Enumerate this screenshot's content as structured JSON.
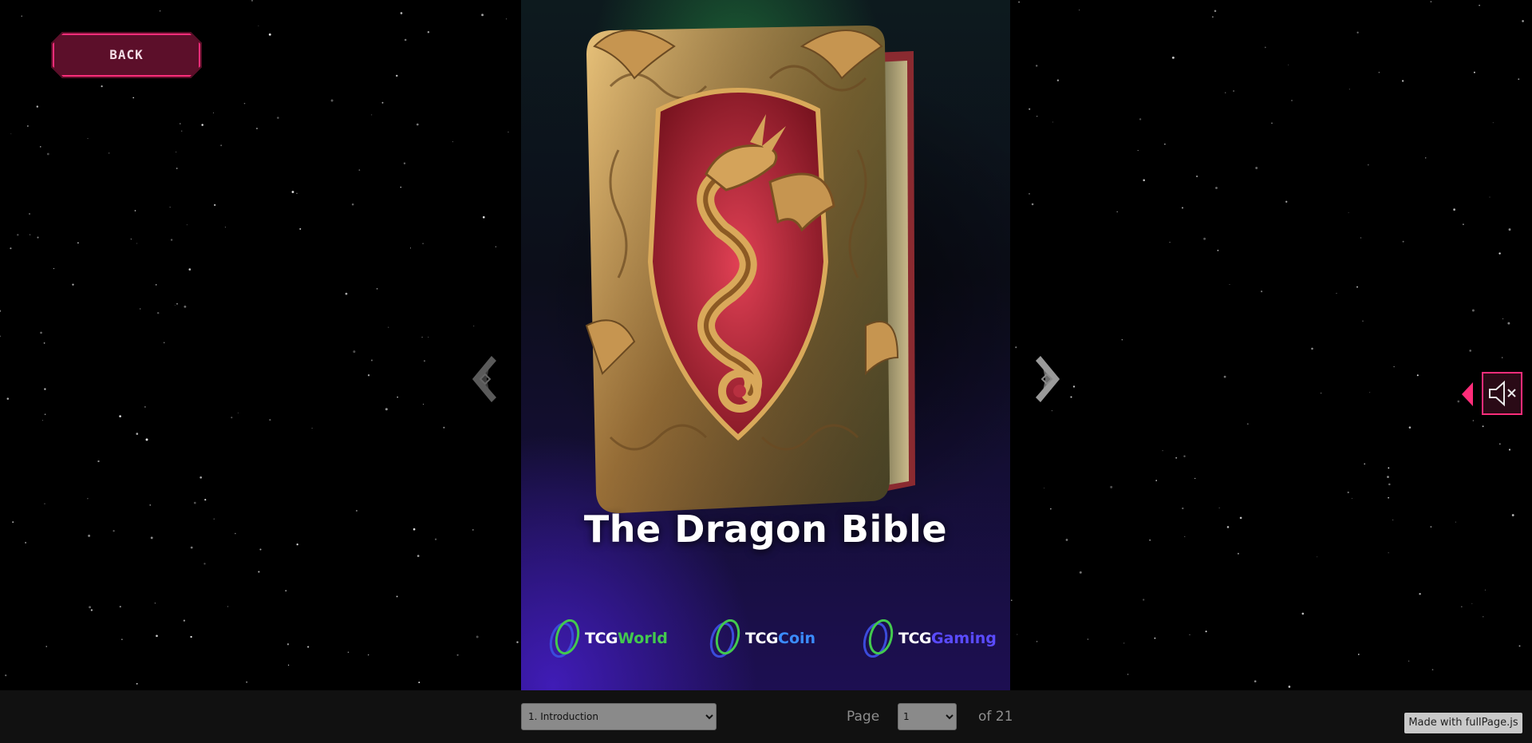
{
  "back_button": {
    "label": "BACK"
  },
  "book": {
    "title": "The Dragon Bible",
    "logos": [
      {
        "prefix": "TCG",
        "suffix": "World",
        "suffix_color": "#43c94e"
      },
      {
        "prefix": "TCG",
        "suffix": "Coin",
        "suffix_color": "#3b8cff"
      },
      {
        "prefix": "TCG",
        "suffix": "Gaming",
        "suffix_color": "#5a4bff"
      }
    ]
  },
  "navigation": {
    "prev_icon": "chevron-left-icon",
    "next_icon": "chevron-right-icon"
  },
  "sound": {
    "icon": "speaker-muted-icon",
    "state": "muted"
  },
  "footer": {
    "chapter_selected": "1. Introduction",
    "page_label": "Page",
    "page_selected": "1",
    "page_total": "of 21",
    "made_with": "Made with fullPage.js"
  },
  "colors": {
    "accent": "#ff2d7a",
    "back_bg": "#5a0e28",
    "bottom_bar": "#111111"
  }
}
